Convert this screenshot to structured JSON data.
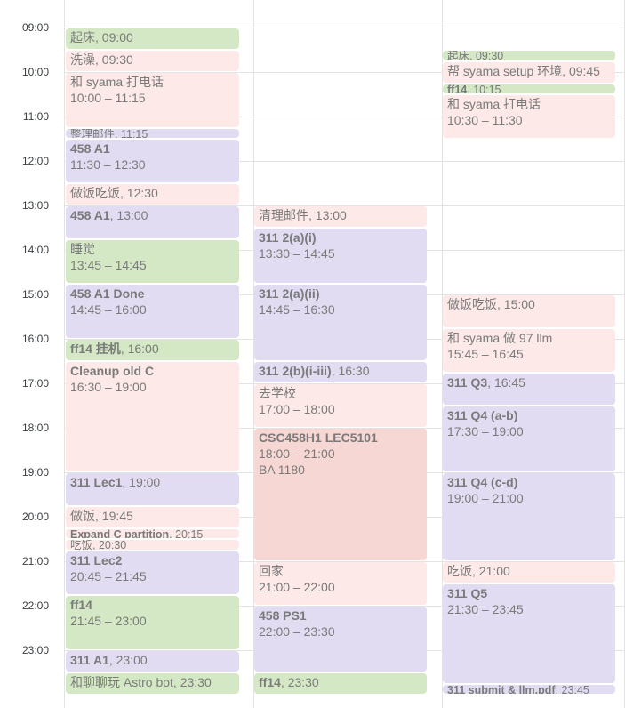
{
  "hours": [
    "09:00",
    "10:00",
    "11:00",
    "12:00",
    "13:00",
    "14:00",
    "15:00",
    "16:00",
    "17:00",
    "18:00",
    "19:00",
    "20:00",
    "21:00",
    "22:00",
    "23:00"
  ],
  "columns": [
    {
      "events": [
        {
          "title": "起床",
          "time": "09:00",
          "start": "09:00",
          "end": "09:30",
          "color": "green",
          "layout": "inline"
        },
        {
          "title": "洗澡",
          "time": "09:30",
          "start": "09:30",
          "end": "10:00",
          "color": "pink",
          "layout": "inline"
        },
        {
          "title": "和 syama 打电话",
          "time": "10:00 – 11:15",
          "start": "10:00",
          "end": "11:15",
          "color": "pink",
          "layout": "block"
        },
        {
          "title": "整理邮件",
          "time": "11:15",
          "start": "11:15",
          "end": "11:30",
          "color": "purple",
          "layout": "compact"
        },
        {
          "title": "458 A1",
          "time": "11:30 – 12:30",
          "start": "11:30",
          "end": "12:30",
          "color": "purple",
          "layout": "block",
          "bold": true
        },
        {
          "title": "做饭吃饭",
          "time": "12:30",
          "start": "12:30",
          "end": "13:00",
          "color": "pink",
          "layout": "inline"
        },
        {
          "title": "458 A1",
          "time": "13:00",
          "start": "13:00",
          "end": "13:45",
          "color": "purple",
          "layout": "inline",
          "bold": true
        },
        {
          "title": "睡觉",
          "time": "13:45 – 14:45",
          "start": "13:45",
          "end": "14:45",
          "color": "green",
          "layout": "block"
        },
        {
          "title": "458 A1 Done",
          "time": "14:45 – 16:00",
          "start": "14:45",
          "end": "16:00",
          "color": "purple",
          "layout": "block",
          "bold": true
        },
        {
          "title": "ff14 挂机",
          "time": "16:00",
          "start": "16:00",
          "end": "16:30",
          "color": "green",
          "layout": "inline",
          "bold": true
        },
        {
          "title": "Cleanup old C",
          "time": "16:30 – 19:00",
          "start": "16:30",
          "end": "19:00",
          "color": "pink",
          "layout": "block",
          "bold": true
        },
        {
          "title": "311 Lec1",
          "time": "19:00",
          "start": "19:00",
          "end": "19:45",
          "color": "purple",
          "layout": "inline",
          "bold": true
        },
        {
          "title": "做饭",
          "time": "19:45",
          "start": "19:45",
          "end": "20:15",
          "color": "pink",
          "layout": "inline"
        },
        {
          "title": "Expand C partition",
          "time": "20:15",
          "start": "20:15",
          "end": "20:30",
          "color": "pink",
          "layout": "compact",
          "bold": true
        },
        {
          "title": "吃饭",
          "time": "20:30",
          "start": "20:30",
          "end": "20:45",
          "color": "pink",
          "layout": "compact"
        },
        {
          "title": "311 Lec2",
          "time": "20:45 – 21:45",
          "start": "20:45",
          "end": "21:45",
          "color": "purple",
          "layout": "block",
          "bold": true
        },
        {
          "title": "ff14",
          "time": "21:45 – 23:00",
          "start": "21:45",
          "end": "23:00",
          "color": "green",
          "layout": "block",
          "bold": true
        },
        {
          "title": "311 A1",
          "time": "23:00",
          "start": "23:00",
          "end": "23:30",
          "color": "purple",
          "layout": "inline",
          "bold": true
        },
        {
          "title": "和聊聊玩 Astro bot",
          "time": "23:30",
          "start": "23:30",
          "end": "24:00",
          "color": "green",
          "layout": "inline"
        }
      ]
    },
    {
      "events": [
        {
          "title": "清理邮件",
          "time": "13:00",
          "start": "13:00",
          "end": "13:30",
          "color": "pink",
          "layout": "inline"
        },
        {
          "title": "311 2(a)(i)",
          "time": "13:30 – 14:45",
          "start": "13:30",
          "end": "14:45",
          "color": "purple",
          "layout": "block",
          "bold": true
        },
        {
          "title": "311 2(a)(ii)",
          "time": "14:45 – 16:30",
          "start": "14:45",
          "end": "16:30",
          "color": "purple",
          "layout": "block",
          "bold": true
        },
        {
          "title": "311 2(b)(i-iii)",
          "time": "16:30",
          "start": "16:30",
          "end": "17:00",
          "color": "purple",
          "layout": "inline",
          "bold": true
        },
        {
          "title": "去学校",
          "time": "17:00 – 18:00",
          "start": "17:00",
          "end": "18:00",
          "color": "pink",
          "layout": "block"
        },
        {
          "title": "CSC458H1 LEC5101",
          "time": "18:00 – 21:00",
          "location": "BA 1180",
          "start": "18:00",
          "end": "21:00",
          "color": "salmon",
          "layout": "block",
          "bold": true
        },
        {
          "title": "回家",
          "time": "21:00 – 22:00",
          "start": "21:00",
          "end": "22:00",
          "color": "pink",
          "layout": "block"
        },
        {
          "title": "458 PS1",
          "time": "22:00 – 23:30",
          "start": "22:00",
          "end": "23:30",
          "color": "purple",
          "layout": "block",
          "bold": true
        },
        {
          "title": "ff14",
          "time": "23:30",
          "start": "23:30",
          "end": "24:00",
          "color": "green",
          "layout": "inline",
          "bold": true
        }
      ]
    },
    {
      "events": [
        {
          "title": "起床",
          "time": "09:30",
          "start": "09:30",
          "end": "09:45",
          "color": "green",
          "layout": "compact"
        },
        {
          "title": "帮 syama setup 环境",
          "time": "09:45",
          "start": "09:45",
          "end": "10:15",
          "color": "pink",
          "layout": "inline"
        },
        {
          "title": "ff14",
          "time": "10:15",
          "start": "10:15",
          "end": "10:30",
          "color": "green",
          "layout": "compact",
          "bold": true
        },
        {
          "title": "和 syama 打电话",
          "time": "10:30 – 11:30",
          "start": "10:30",
          "end": "11:30",
          "color": "pink",
          "layout": "block"
        },
        {
          "title": "做饭吃饭",
          "time": "15:00",
          "start": "15:00",
          "end": "15:45",
          "color": "pink",
          "layout": "inline"
        },
        {
          "title": "和 syama 做 97 llm",
          "time": "15:45 – 16:45",
          "start": "15:45",
          "end": "16:45",
          "color": "pink",
          "layout": "block"
        },
        {
          "title": "311 Q3",
          "time": "16:45",
          "start": "16:45",
          "end": "17:30",
          "color": "purple",
          "layout": "inline",
          "bold": true
        },
        {
          "title": "311 Q4 (a-b)",
          "time": "17:30 – 19:00",
          "start": "17:30",
          "end": "19:00",
          "color": "purple",
          "layout": "block",
          "bold": true
        },
        {
          "title": "311 Q4 (c-d)",
          "time": "19:00 – 21:00",
          "start": "19:00",
          "end": "21:00",
          "color": "purple",
          "layout": "block",
          "bold": true
        },
        {
          "title": "吃饭",
          "time": "21:00",
          "start": "21:00",
          "end": "21:30",
          "color": "pink",
          "layout": "inline"
        },
        {
          "title": "311 Q5",
          "time": "21:30 – 23:45",
          "start": "21:30",
          "end": "23:45",
          "color": "purple",
          "layout": "block",
          "bold": true
        },
        {
          "title": "311 submit & llm.pdf",
          "time": "23:45",
          "start": "23:45",
          "end": "24:00",
          "color": "purple",
          "layout": "compact",
          "bold": true
        }
      ]
    }
  ]
}
